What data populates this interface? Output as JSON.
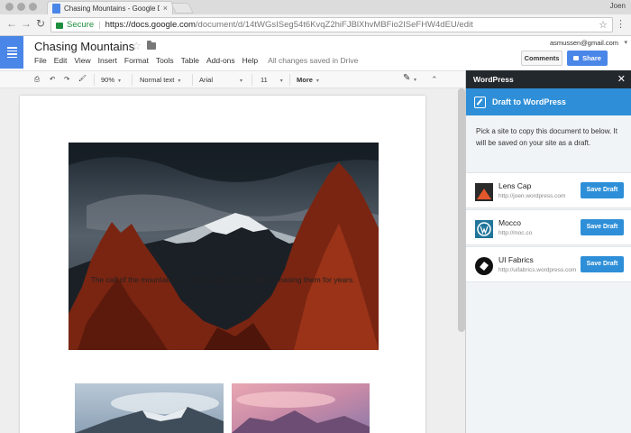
{
  "browser": {
    "tab_title": "Chasing Mountains - Google D",
    "tab_close": "×",
    "profile_name": "Joen",
    "secure_label": "Secure",
    "url_host": "https://docs.google.com",
    "url_path": "/document/d/14tWGsISeg54t6KvqZ2hiFJBlXhvMBFio2ISeFHW4dEU/edit",
    "back": "←",
    "forward": "→",
    "reload": "↻",
    "bookmark": "☆",
    "menu": "⋮"
  },
  "docs": {
    "title": "Chasing Mountains",
    "title_star": "☆",
    "menus": [
      "File",
      "Edit",
      "View",
      "Insert",
      "Format",
      "Tools",
      "Table",
      "Add-ons",
      "Help"
    ],
    "saved_status": "All changes saved in Drive",
    "account_email": "asmussen@gmail.com",
    "account_caret": "▾",
    "comments_label": "Comments",
    "share_label": "Share"
  },
  "toolbar": {
    "print": "⎙",
    "undo": "↶",
    "redo": "↷",
    "paint": "🖌",
    "zoom": "90%",
    "style": "Normal text",
    "font": "Arial",
    "size": "11",
    "more": "More",
    "caret": "▾",
    "pen": "✎",
    "collapse": "⌃"
  },
  "document": {
    "caption": "The call of the mountains is a strong one. We've been chasing them for years."
  },
  "wordpress": {
    "header": "WordPress",
    "close": "✕",
    "action_title": "Draft to WordPress",
    "description": "Pick a site to copy this document to below. It will be saved on your site as a draft.",
    "button_label": "Save Draft",
    "sites": [
      {
        "name": "Lens Cap",
        "url": "http://joen.wordpress.com"
      },
      {
        "name": "Mocco",
        "url": "http://moc.co"
      },
      {
        "name": "UI Fabrics",
        "url": "http://uifabrics.wordpress.com"
      }
    ]
  },
  "colors": {
    "docs_blue": "#4a86e8",
    "wp_blue": "#2e8fd8",
    "wp_dark": "#23282d",
    "secure_green": "#1e8e3e"
  }
}
